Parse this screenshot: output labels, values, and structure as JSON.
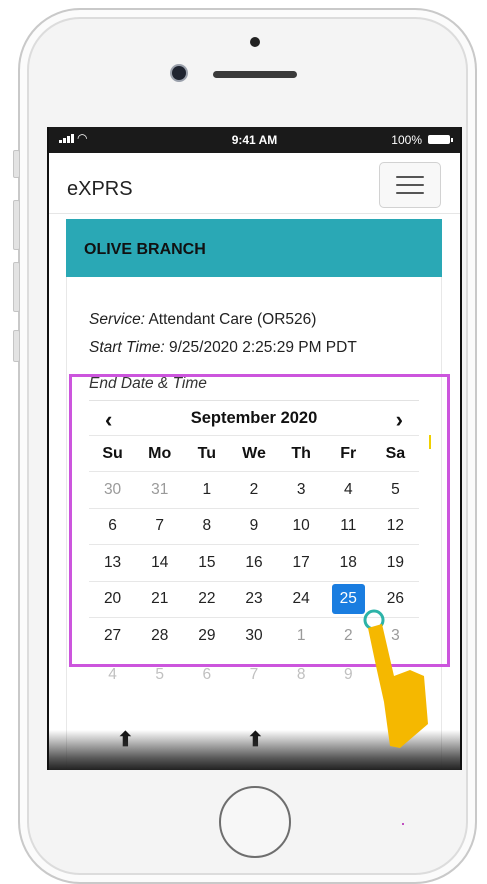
{
  "status_bar": {
    "time": "9:41 AM",
    "battery": "100%"
  },
  "navbar": {
    "brand": "eXPRS"
  },
  "card": {
    "title": "OLIVE BRANCH",
    "service_label": "Service:",
    "service_value": "Attendant Care (OR526)",
    "start_label": "Start Time:",
    "start_value": "9/25/2020 2:25:29 PM PDT",
    "end_label": "End Date & Time"
  },
  "calendar": {
    "prev": "‹",
    "next": "›",
    "month": "September 2020",
    "days_of_week": [
      "Su",
      "Mo",
      "Tu",
      "We",
      "Th",
      "Fr",
      "Sa"
    ],
    "weeks": [
      [
        "30",
        "31",
        "1",
        "2",
        "3",
        "4",
        "5"
      ],
      [
        "6",
        "7",
        "8",
        "9",
        "10",
        "11",
        "12"
      ],
      [
        "13",
        "14",
        "15",
        "16",
        "17",
        "18",
        "19"
      ],
      [
        "20",
        "21",
        "22",
        "23",
        "24",
        "25",
        "26"
      ],
      [
        "27",
        "28",
        "29",
        "30",
        "1",
        "2",
        "3"
      ]
    ],
    "muted_cells": [
      [
        0,
        0
      ],
      [
        0,
        1
      ],
      [
        4,
        4
      ],
      [
        4,
        5
      ],
      [
        4,
        6
      ]
    ],
    "selected_cell": [
      3,
      5
    ],
    "next_row_partial": [
      "4",
      "5",
      "6",
      "7",
      "8",
      "9",
      ""
    ]
  },
  "time_picker": {
    "up_arrow": "⬆"
  },
  "colors": {
    "header": "#2aa8b5",
    "selected": "#1a7de0",
    "highlight": "#cc55dd"
  }
}
